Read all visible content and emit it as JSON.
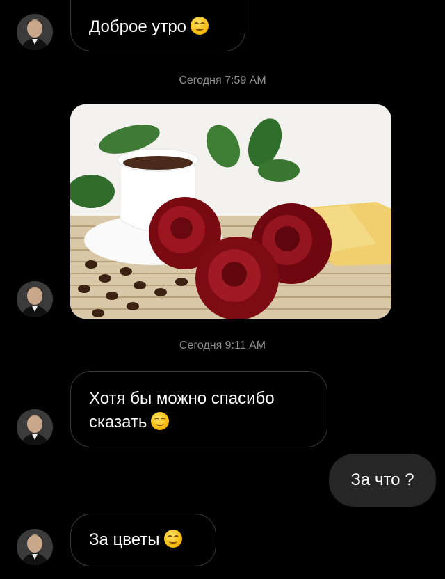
{
  "messages": [
    {
      "text": "Доброе утро",
      "emoji": "smiling-face-icon"
    },
    {
      "text": "Хотя бы можно спасибо",
      "text2": "сказать",
      "emoji": "smiling-face-icon"
    },
    {
      "text": "За что ?"
    },
    {
      "text": "За цветы",
      "emoji": "smiling-face-icon"
    }
  ],
  "timestamps": [
    "Сегодня 7:59 AM",
    "Сегодня 9:11 AM"
  ],
  "photo": {
    "icon": "coffee-roses-photo"
  },
  "colors": {
    "background": "#000000",
    "outgoing_bubble": "#262626",
    "incoming_border": "#3a3a3a",
    "timestamp": "#8e8e8e"
  }
}
